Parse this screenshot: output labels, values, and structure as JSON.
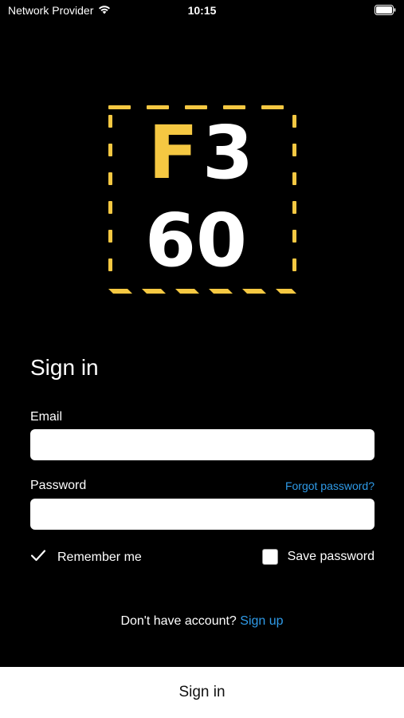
{
  "status_bar": {
    "carrier": "Network Provider",
    "time": "10:15",
    "wifi_icon": "wifi-icon",
    "battery_icon": "battery-icon"
  },
  "logo": {
    "line1_left": "F",
    "line1_right": "3",
    "line2": "60",
    "colors": {
      "accent": "#f5c842",
      "text": "#ffffff",
      "background": "#000000"
    }
  },
  "form": {
    "heading": "Sign in",
    "email_label": "Email",
    "email_value": "",
    "password_label": "Password",
    "password_value": "",
    "forgot_password": "Forgot password?",
    "remember_me": "Remember me",
    "remember_me_checked": true,
    "save_password": "Save password",
    "save_password_checked": false
  },
  "signup": {
    "prompt": "Don't have account?",
    "link": "Sign up"
  },
  "bottom_bar": {
    "label": "Sign in"
  },
  "colors": {
    "link": "#2f9be8",
    "background": "#000000",
    "bottom_bar": "#ffffff"
  }
}
